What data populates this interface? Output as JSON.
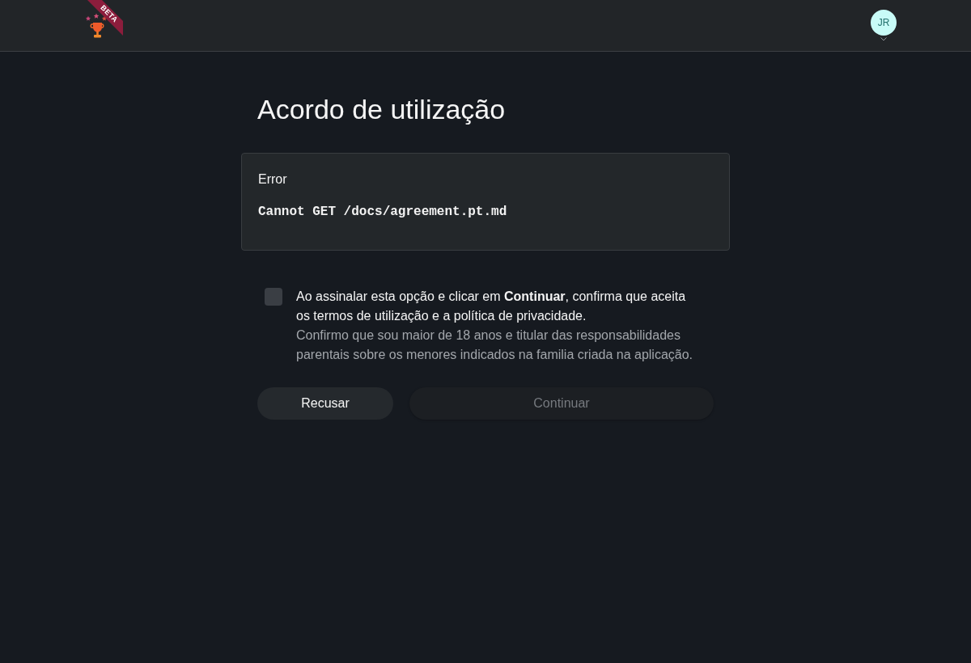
{
  "header": {
    "logo": {
      "ribbon": "BETA"
    },
    "user_menu": {
      "initials": "JR"
    }
  },
  "title": "Acordo de utilização",
  "error_panel": {
    "heading": "Error",
    "message": "Cannot GET /docs/agreement.pt.md"
  },
  "consent": {
    "checked": false,
    "text": "Ao assinalar esta opção e clicar em **Continuar**, confirma que aceita os termos de utilização e a política de privacidade.",
    "note": "Confirmo que sou maior de 18 anos e titular das responsabilidades parentais sobre os menores indicados na familia criada na aplicação."
  },
  "buttons": [
    {
      "label": "Recusar",
      "kind": "secondary",
      "disabled": false
    },
    {
      "label": "Continuar",
      "kind": "primary",
      "disabled": true
    }
  ]
}
